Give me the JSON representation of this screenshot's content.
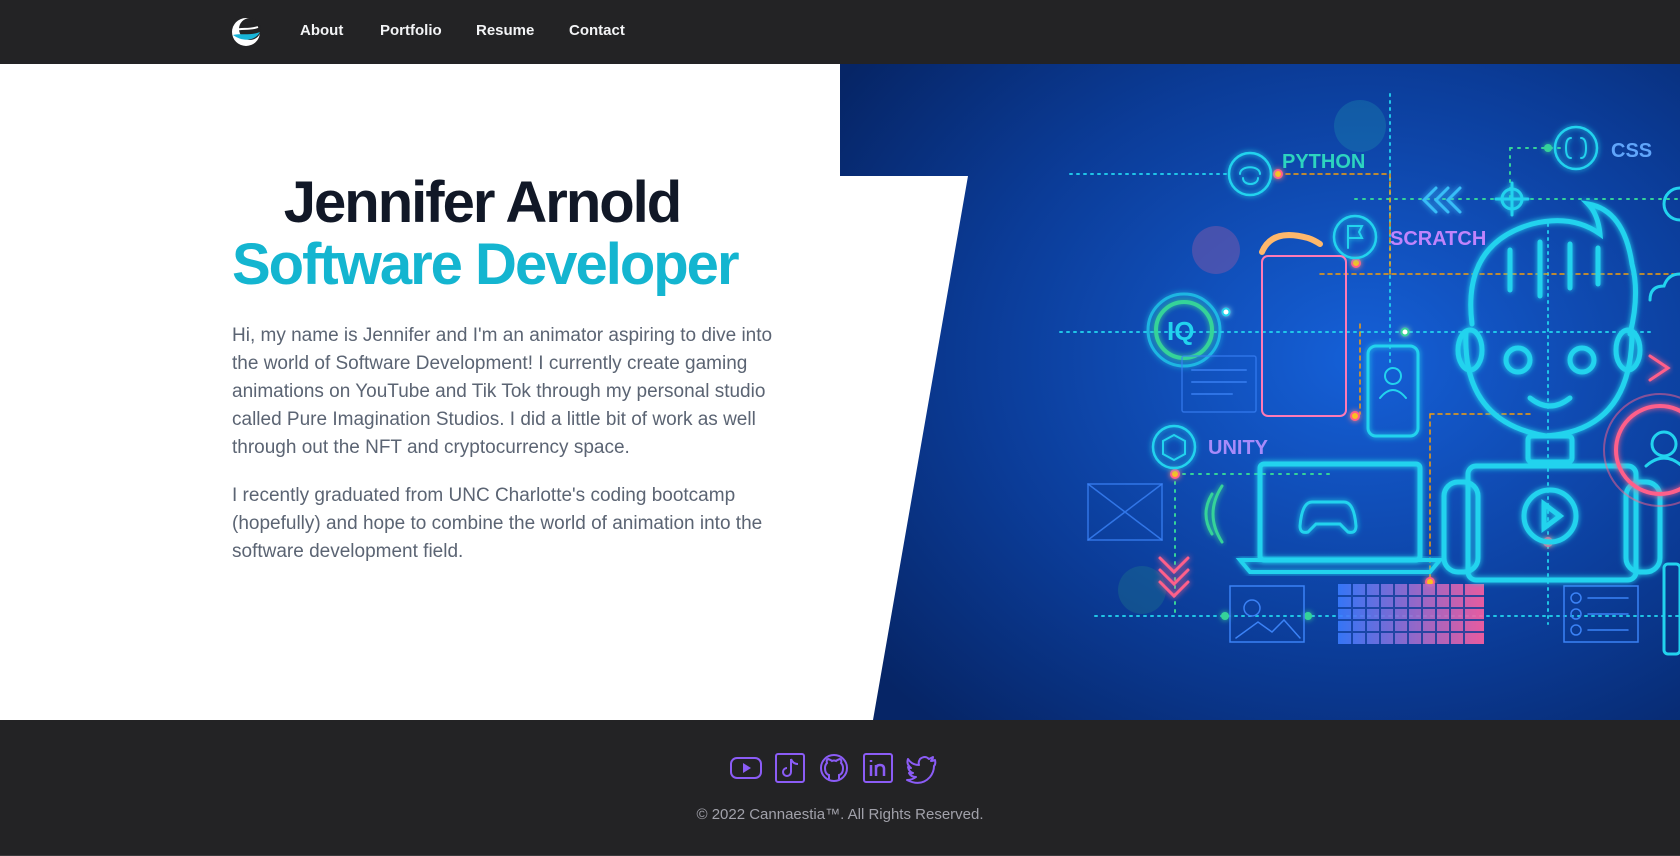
{
  "nav": {
    "logo_icon": "half-moon-logo-icon",
    "links": [
      {
        "label": "About"
      },
      {
        "label": "Portfolio"
      },
      {
        "label": "Resume"
      },
      {
        "label": "Contact"
      }
    ]
  },
  "hero": {
    "name": "Jennifer Arnold",
    "role": "Software Developer",
    "paragraphs": [
      "Hi, my name is Jennifer and I'm an animator aspiring to dive into the world of Software Development! I currently create gaming animations on YouTube and Tik Tok through my personal studio called Pure Imagination Studios. I did a little bit of work as well through out the NFT and cryptocurrency space.",
      "I recently graduated from UNC Charlotte's coding bootcamp (hopefully) and hope to combine the world of animation into the software development field."
    ],
    "illustration": {
      "labels": {
        "python": "PYTHON",
        "css": "CSS",
        "scratch": "SCRATCH",
        "iq": "IQ",
        "unity": "UNITY"
      }
    }
  },
  "footer": {
    "social": [
      {
        "icon": "youtube-icon"
      },
      {
        "icon": "tiktok-icon"
      },
      {
        "icon": "github-icon"
      },
      {
        "icon": "linkedin-icon"
      },
      {
        "icon": "twitter-icon"
      }
    ],
    "copyright": "© 2022 Cannaestia™. All Rights Reserved."
  },
  "colors": {
    "nav_bg": "#232325",
    "accent": "#14b5d0",
    "heading": "#111827",
    "body_text": "#5b6473",
    "icon_purple": "#8b5cf6",
    "art_bg": "#0b3c98",
    "neon_cyan": "#00e5ff"
  }
}
